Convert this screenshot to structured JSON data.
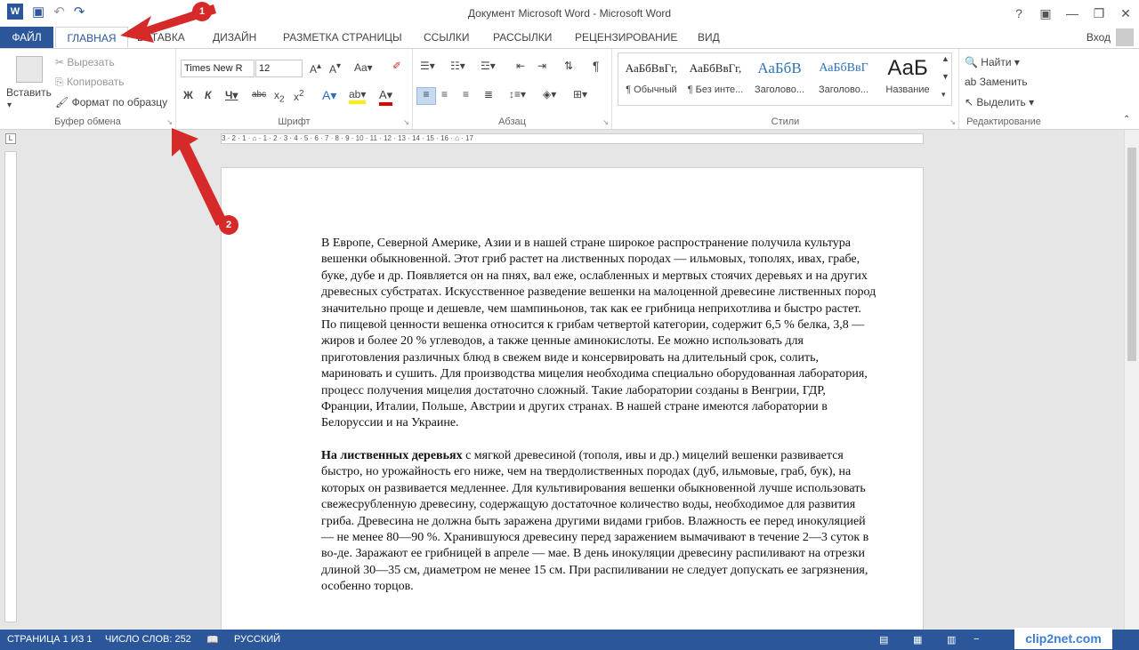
{
  "window": {
    "title": "Документ Microsoft Word - Microsoft Word",
    "app_icon": "W",
    "controls": [
      "?",
      "▣",
      "—",
      "❐",
      "✕"
    ]
  },
  "tabs": {
    "file": "ФАЙЛ",
    "active": "ГЛАВНАЯ",
    "insert": "ВСТАВКА",
    "design": "ДИЗАЙН",
    "layout": "РАЗМЕТКА СТРАНИЦЫ",
    "references": "ССЫЛКИ",
    "mailings": "РАССЫЛКИ",
    "review": "РЕЦЕНЗИРОВАНИЕ",
    "view": "ВИД",
    "login": "Вход"
  },
  "clipboard": {
    "paste": "Вставить",
    "cut": "Вырезать",
    "copy": "Копировать",
    "format_painter": "Формат по образцу",
    "label": "Буфер обмена"
  },
  "font": {
    "name": "Times New R",
    "size": "12",
    "label": "Шрифт"
  },
  "paragraph": {
    "label": "Абзац"
  },
  "styles": {
    "items": [
      {
        "sample": "АаБбВвГг,",
        "name": "¶ Обычный"
      },
      {
        "sample": "АаБбВвГг,",
        "name": "¶ Без инте..."
      },
      {
        "sample": "АаБбВ",
        "name": "Заголово..."
      },
      {
        "sample": "АаБбВвГ",
        "name": "Заголово..."
      },
      {
        "sample": "АаБ",
        "name": "Название"
      }
    ],
    "label": "Стили"
  },
  "editing": {
    "find": "Найти",
    "replace": "Заменить",
    "select": "Выделить",
    "label": "Редактирование"
  },
  "ruler": {
    "marks": "3 · 2 · 1 · ⌂ · 1 · 2 · 3 · 4 · 5 · 6 · 7 · 8 · 9 · 10 · 11 · 12 · 13 · 14 · 15 · 16 · ⌂ · 17"
  },
  "document": {
    "p1": "В Европе, Северной Америке, Азии и в нашей стране широкое распространение получила культура вешенки обыкновенной. Этот гриб растет на лиственных породах — ильмовых, тополях, ивах, грабе, буке, дубе и др. Появляется он на пнях, вал еже, ослабленных и мертвых стоячих деревьях и на других древесных субстратах. Искусственное разведение вешенки на малоценной древесине лиственных пород значительно проще и дешевле, чем шампиньонов, так как ее грибница неприхотлива и быстро растет. По пищевой ценности вешенка относится к грибам четвертой категории, содержит 6,5 % белка, 3,8 — жиров и более 20 % углеводов, а также ценные аминокислоты. Ее можно использовать для приготовления различных блюд в свежем виде и консервировать на длительный срок, солить, мариновать и сушить. Для производства мицелия необходима специально оборудованная лаборатория, процесс получения мицелия достаточно сложный. Такие лаборатории созданы в Венгрии, ГДР, Франции, Италии, Польше, Австрии и других странах. В нашей стране имеются лаборатории в Белоруссии и на Украине.",
    "p2_bold": "На лиственных деревьях",
    "p2": " с мягкой древесиной (тополя, ивы и др.) мицелий вешенки развивается быстро, но урожайность его ниже, чем на твердолиственных породах (дуб, ильмовые, граб, бук), на которых он развивается медленнее. Для культивирования вешенки обыкновенной лучше использовать свежесрубленную древесину, содержащую достаточное количество воды, необходимое для развития гриба. Древесина не должна быть заражена другими видами грибов. Влажность ее перед инокуляцией — не менее 80—90 %. Хранившуюся древесину перед заражением вымачивают в течение 2—3 суток в во-де. Заражают ее грибницей в апреле — мае. В день инокуляции древесину распиливают на отрезки длиной 30—35 см, диаметром не менее 15 см. При распиливании не следует допускать ее загрязнения, особенно торцов."
  },
  "status": {
    "page": "СТРАНИЦА 1 ИЗ 1",
    "words": "ЧИСЛО СЛОВ: 252",
    "language": "РУССКИЙ"
  },
  "annotations": {
    "arrow1": "1",
    "arrow2": "2"
  },
  "watermark": "clip2net.com",
  "colors": {
    "accent": "#2b579a",
    "arrow": "#d62a2a"
  }
}
